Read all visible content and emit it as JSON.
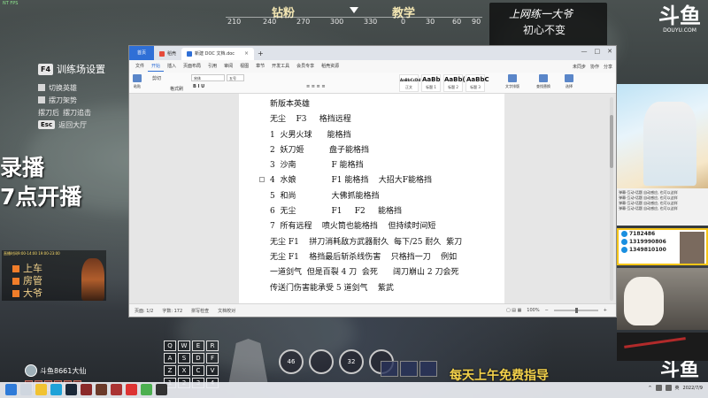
{
  "game": {
    "fps": "NT FPS",
    "compass": {
      "names": [
        "钻粉",
        "教学"
      ],
      "ticks": [
        "210",
        "240",
        "270",
        "300",
        "330",
        "0",
        "30",
        "60",
        "90"
      ]
    },
    "training_menu": {
      "key": "F4",
      "title": "训练场设置",
      "items": [
        {
          "key": "",
          "label": "切换英雄"
        },
        {
          "key": "",
          "label": "摆刀架势"
        },
        {
          "key": "摆刀后",
          "label": "摆刀追击"
        },
        {
          "key": "Esc",
          "label": "返回大厅"
        }
      ]
    },
    "recording_text": "录播",
    "time_text": "7点开播",
    "schedule": {
      "header": "直播时间9:00-14:00 19:00-23:00",
      "rows": [
        "上车",
        "房管",
        "大爷"
      ]
    },
    "player_name": "斗鱼8661大仙",
    "hud_keys": [
      "Q",
      "W",
      "E",
      "R",
      "A",
      "S",
      "D",
      "F",
      "Z",
      "X",
      "C",
      "V",
      "1",
      "2",
      "3",
      "4"
    ],
    "skills": [
      "46",
      "",
      "32",
      ""
    ],
    "bottom_banner": "每天上午免费指导"
  },
  "brand": {
    "banner_line1": "上网练一大爷",
    "banner_line2": "初心不变",
    "logo": "斗鱼",
    "logo_sub": "DOUYU.COM",
    "logo_bottom": "斗鱼"
  },
  "right_panel": {
    "chat": [
      "弹幕-互动-话题    自动感应, 也可以这样",
      "弹幕-互动-话题    自动感应, 也可以这样",
      "弹幕-互动-话题    自动感应, 也可以这样",
      "弹幕-互动-话题    自动感应, 也可以这样"
    ],
    "bot_rows": [
      "7182486",
      "1319990806",
      "1349810100"
    ]
  },
  "wps": {
    "tabs": {
      "home": "首页",
      "dao": "稻壳",
      "doc": "新建 DOC 文档.doc",
      "plus": "+"
    },
    "window_controls": [
      "—",
      "□",
      "✕"
    ],
    "menu": [
      "文件",
      "开始",
      "插入",
      "页面布局",
      "引用",
      "审阅",
      "视图",
      "章节",
      "开发工具",
      "会员专享",
      "稻壳资源"
    ],
    "menu_active": "开始",
    "menu_right": [
      "未同步",
      "协作",
      "分享"
    ],
    "ribbon": {
      "paste": "粘贴",
      "cut": "剪切",
      "format_painter": "格式刷",
      "font": "宋体",
      "size": "五号",
      "styles": [
        {
          "big": "AaBbCcDd",
          "sm": "正文"
        },
        {
          "big": "AaBb",
          "sm": "标题 1"
        },
        {
          "big": "AaBb(",
          "sm": "标题 2"
        },
        {
          "big": "AaBbC",
          "sm": "标题 3"
        }
      ],
      "text_tools": "文字排版",
      "find_replace": "查找替换",
      "select": "选择"
    },
    "doc_lines": [
      "新版本英雄",
      "无尘    F3     格挡远程",
      "1  火男火球      能格挡",
      "2  妖刀姬          盘子能格挡",
      "3  沙南              F 能格挡",
      "4  水娘              F1 能格挡    大招大F能格挡",
      "5  和尚              大佛抓能格挡",
      "6  无尘              F1     F2     能格挡",
      "7  所有远程    喷火筒也能格挡    但持续时间短",
      "无尘 F1    拼刀消耗敌方武器耐久  每下/25 耐久  紫刀",
      "无尘 F1    格挡最后斩杀线伤害    只格挡一刀    例如",
      "一道剑气  但是百裂 4 刀  会死      阔刀崩山 2 刀会死",
      "传送门伤害能承受 5 道剑气    紫武"
    ],
    "status": {
      "page": "页面: 1/2",
      "words": "字数: 172",
      "spell": "拼写检查",
      "doc_check": "文档校对",
      "zoom": "100%"
    }
  },
  "taskbar": {
    "apps": [
      "start",
      "search",
      "files",
      "edge",
      "steam",
      "game1",
      "game2",
      "game3",
      "wps",
      "chrome",
      "obs"
    ],
    "tray": [
      "^",
      "英",
      "2022/7/9"
    ]
  }
}
